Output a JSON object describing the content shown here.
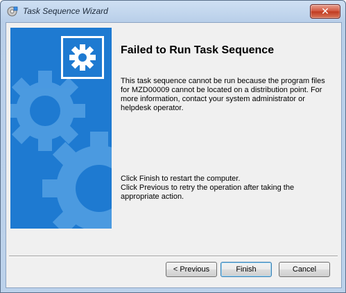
{
  "window": {
    "title": "Task Sequence Wizard",
    "close_label": "✕"
  },
  "colors": {
    "banner": "#1e7ad1",
    "gear_fill": "#5aa5e6",
    "close_button": "#c0391f"
  },
  "icons": {
    "title": "wizard-app-icon",
    "logo": "gear-icon"
  },
  "content": {
    "heading": "Failed to Run Task Sequence",
    "message": "This task sequence cannot be run because the program files for MZD00009 cannot be located on a distribution point. For more information, contact your system administrator or helpdesk operator.",
    "instructions_line1": "Click Finish to restart the computer.",
    "instructions_line2": "Click Previous to retry the operation after taking the appropriate action."
  },
  "buttons": {
    "previous": "< Previous",
    "finish": "Finish",
    "cancel": "Cancel"
  }
}
